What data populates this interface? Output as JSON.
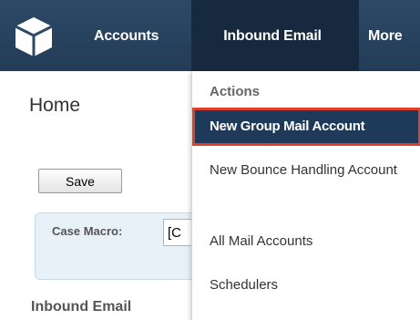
{
  "navbar": {
    "logo_icon": "cube-logo-icon",
    "tabs": [
      {
        "label": "Accounts"
      },
      {
        "label": "Inbound Email"
      },
      {
        "label": "More"
      }
    ]
  },
  "page": {
    "title": "Home",
    "save_label": "Save",
    "macro_label": "Case Macro:",
    "macro_value": "[C",
    "section_heading": "Inbound Email"
  },
  "dropdown": {
    "header": "Actions",
    "items": [
      {
        "label": "New Group Mail Account"
      },
      {
        "label": "New Bounce Handling Account"
      },
      {
        "label": "All Mail Accounts"
      },
      {
        "label": "Schedulers"
      }
    ]
  },
  "colors": {
    "navbar": "#2d4967",
    "active_tab": "#16293e",
    "highlight_item": "#1d3a5a",
    "highlight_border": "#e0402b"
  }
}
